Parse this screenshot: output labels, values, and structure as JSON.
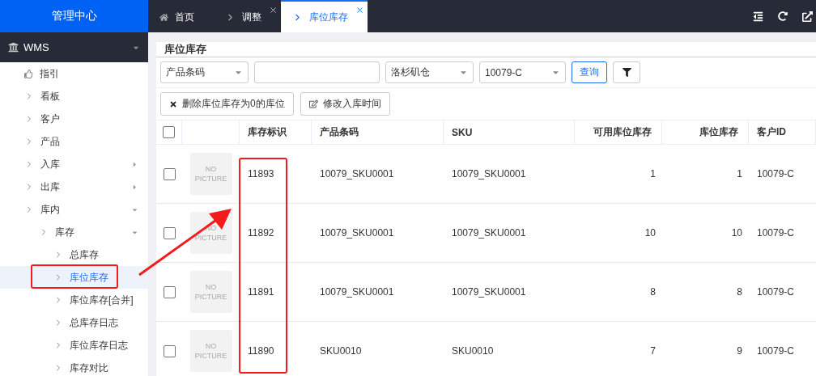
{
  "sidebar": {
    "title": "管理中心",
    "module": {
      "label": "WMS",
      "expanded": true
    },
    "items": [
      {
        "label": "指引",
        "kind": "guide",
        "selected": false
      },
      {
        "label": "看板",
        "kind": "link",
        "selected": false
      },
      {
        "label": "客户",
        "kind": "link",
        "selected": false
      },
      {
        "label": "产品",
        "kind": "link",
        "selected": false
      },
      {
        "label": "入库",
        "kind": "group",
        "expanded": false,
        "selected": false
      },
      {
        "label": "出库",
        "kind": "group",
        "expanded": false,
        "selected": false
      },
      {
        "label": "库内",
        "kind": "group",
        "expanded": true,
        "selected": false,
        "children": [
          {
            "label": "库存",
            "kind": "group",
            "expanded": true,
            "selected": false,
            "children": [
              {
                "label": "总库存",
                "kind": "link",
                "selected": false
              },
              {
                "label": "库位库存",
                "kind": "link",
                "selected": true
              },
              {
                "label": "库位库存[合并]",
                "kind": "link",
                "selected": false
              },
              {
                "label": "总库存日志",
                "kind": "link",
                "selected": false
              },
              {
                "label": "库位库存日志",
                "kind": "link",
                "selected": false
              },
              {
                "label": "库存对比",
                "kind": "link",
                "selected": false
              }
            ]
          }
        ]
      }
    ]
  },
  "tabs": [
    {
      "label": "首页",
      "kind": "home",
      "selected": false,
      "closable": false
    },
    {
      "label": "调整",
      "kind": "page",
      "selected": false,
      "closable": true
    },
    {
      "label": "库位库存",
      "kind": "page",
      "selected": true,
      "closable": true
    }
  ],
  "page_title": "库位库存",
  "filters": [
    {
      "kind": "select",
      "value": "产品条码"
    },
    {
      "kind": "input"
    },
    {
      "kind": "select",
      "value": "洛杉矶仓"
    },
    {
      "kind": "select",
      "value": "10079-C"
    }
  ],
  "search_button": "查询",
  "actions": [
    {
      "label": "删除库位库存为0的库位",
      "kind": "delete"
    },
    {
      "label": "修改入库时间",
      "kind": "edit"
    }
  ],
  "table": {
    "all_checked": false,
    "columns": [
      "库存标识",
      "产品条码",
      "SKU",
      "可用库位库存",
      "库位库存",
      "客户ID"
    ],
    "rows": [
      {
        "checked": false,
        "image": "NO PICTURE",
        "cells": [
          "11893",
          "10079_SKU0001",
          "10079_SKU0001",
          "1",
          "1",
          "10079-C"
        ]
      },
      {
        "checked": false,
        "image": "NO PICTURE",
        "cells": [
          "11892",
          "10079_SKU0001",
          "10079_SKU0001",
          "10",
          "10",
          "10079-C"
        ]
      },
      {
        "checked": false,
        "image": "NO PICTURE",
        "cells": [
          "11891",
          "10079_SKU0001",
          "10079_SKU0001",
          "8",
          "8",
          "10079-C"
        ]
      },
      {
        "checked": false,
        "image": "NO PICTURE",
        "cells": [
          "11890",
          "SKU0010",
          "SKU0010",
          "7",
          "9",
          "10079-C"
        ]
      }
    ]
  }
}
